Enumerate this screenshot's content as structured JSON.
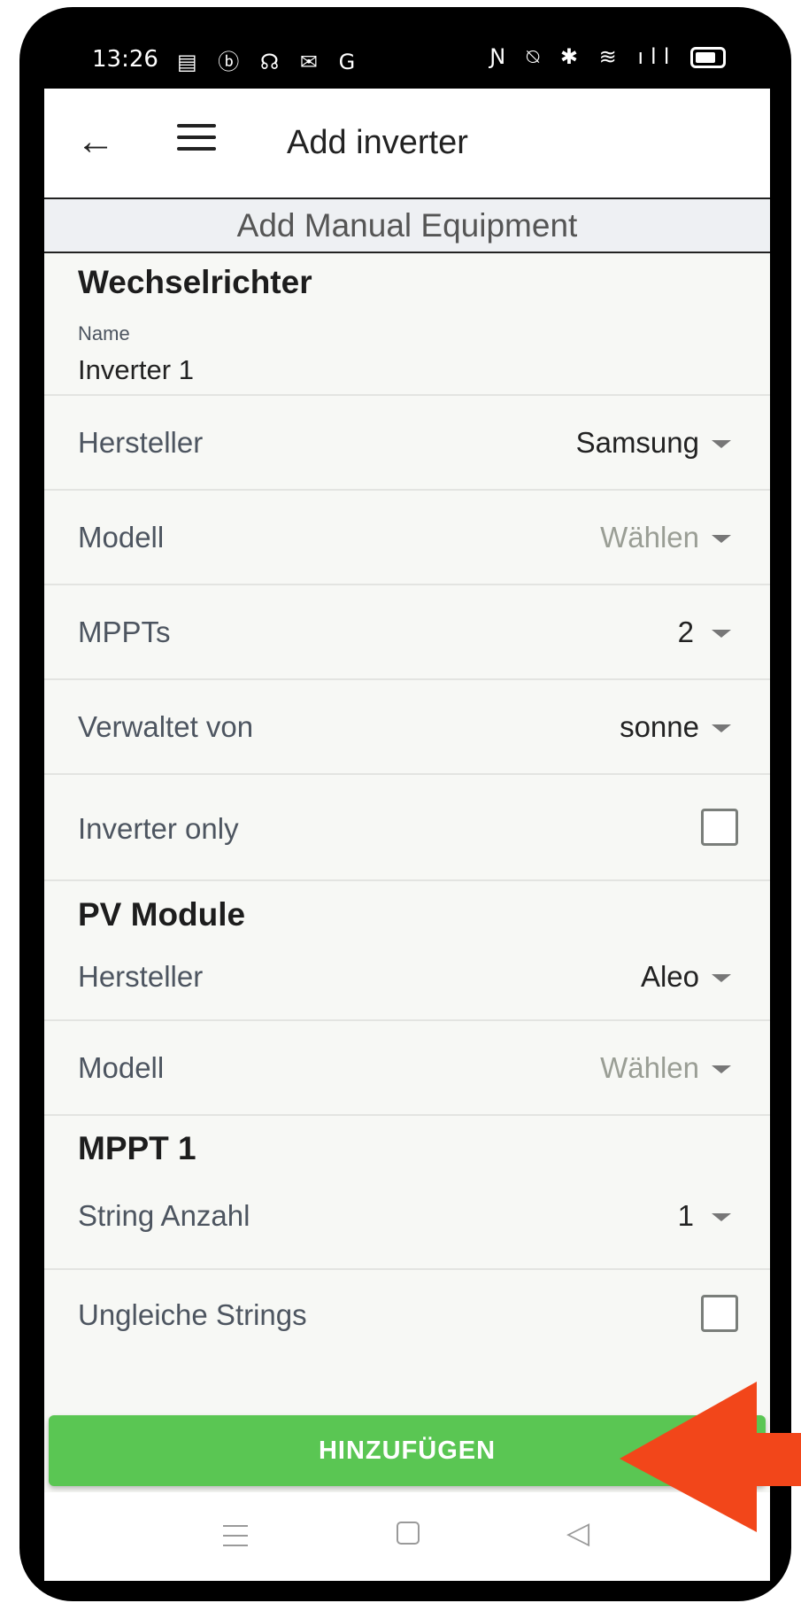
{
  "status_bar": {
    "time": "13:26",
    "left_icons": "▤ ⓑ ☊ ✉ G",
    "right_icons": "Ɲ ⍉ ✱ ≋ ıll"
  },
  "app_bar": {
    "back_icon": "arrow-left-icon",
    "menu_icon": "hamburger-icon",
    "title": "Add inverter"
  },
  "subheader": {
    "title": "Add Manual Equipment"
  },
  "sections": {
    "inverter": {
      "title": "Wechselrichter",
      "name_label": "Name",
      "name_value": "Inverter 1",
      "manufacturer_label": "Hersteller",
      "manufacturer_value": "Samsung",
      "model_label": "Modell",
      "model_value": "Wählen",
      "mppts_label": "MPPTs",
      "mppts_value": "2",
      "managed_by_label": "Verwaltet von",
      "managed_by_value": "sonne",
      "inverter_only_label": "Inverter only",
      "inverter_only_checked": false
    },
    "pv_module": {
      "title": "PV Module",
      "manufacturer_label": "Hersteller",
      "manufacturer_value": "Aleo",
      "model_label": "Modell",
      "model_value": "Wählen"
    },
    "mppt1": {
      "title": "MPPT 1",
      "string_count_label": "String Anzahl",
      "string_count_value": "1",
      "unequal_strings_label": "Ungleiche Strings",
      "unequal_strings_checked": false
    }
  },
  "actions": {
    "add_label": "HINZUFÜGEN"
  },
  "nav_bar": {
    "icons": [
      "menu-icon",
      "home-icon",
      "back-icon"
    ]
  },
  "colors": {
    "primary_button": "#5ac653",
    "annotation_arrow": "#f2461a",
    "background": "#f7f8f5"
  }
}
